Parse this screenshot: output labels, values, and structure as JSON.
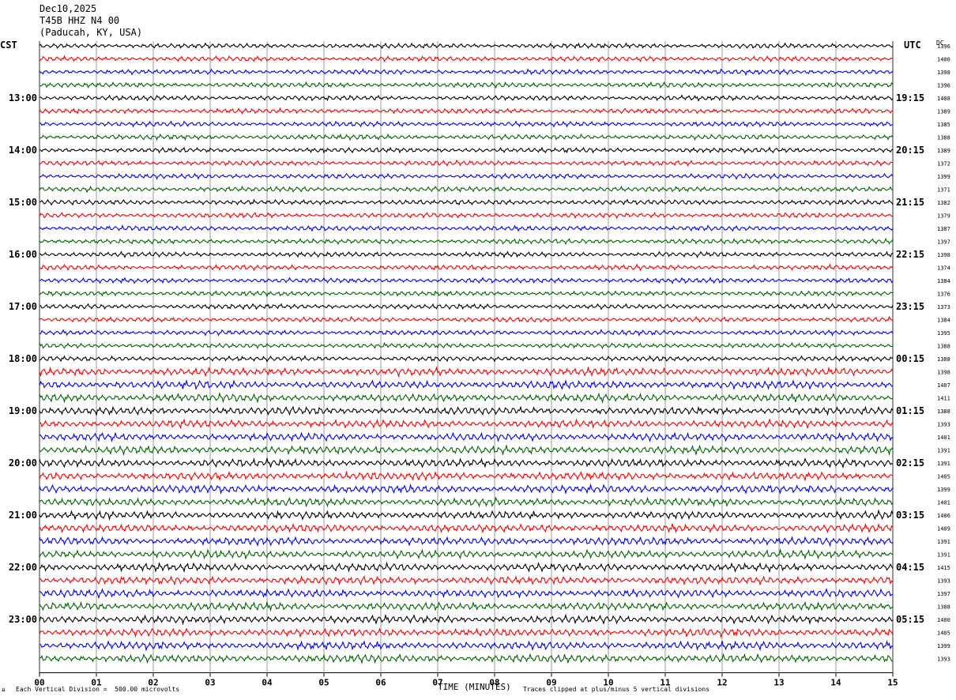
{
  "header": {
    "date": "Dec10,2025",
    "station": "T45B HHZ N4 00",
    "location": "(Paducah, KY, USA)"
  },
  "left_zone": "CST",
  "right_zone": "UTC",
  "dc_label": "DC",
  "footer": {
    "scale_note": "Each Vertical Division =  500.00 microvolts",
    "clip_note": "Traces clipped at plus/minus 5 vertical divisions",
    "corner_mark": "⇊"
  },
  "colors": [
    "#000000",
    "#ff0000",
    "#0000ff",
    "#006400"
  ],
  "chart_data": {
    "type": "line",
    "title": "",
    "xlabel": "TIME (MINUTES)",
    "ylabel": "",
    "xlim": [
      0,
      15
    ],
    "x_ticks": [
      "00",
      "01",
      "02",
      "03",
      "04",
      "05",
      "06",
      "07",
      "08",
      "09",
      "10",
      "11",
      "12",
      "13",
      "14",
      "15"
    ],
    "trace_minutes": 15,
    "trace_count": 48,
    "left_hour_labels": [
      {
        "row": 4,
        "text": "13:00"
      },
      {
        "row": 8,
        "text": "14:00"
      },
      {
        "row": 12,
        "text": "15:00"
      },
      {
        "row": 16,
        "text": "16:00"
      },
      {
        "row": 20,
        "text": "17:00"
      },
      {
        "row": 24,
        "text": "18:00"
      },
      {
        "row": 28,
        "text": "19:00"
      },
      {
        "row": 32,
        "text": "20:00"
      },
      {
        "row": 36,
        "text": "21:00"
      },
      {
        "row": 40,
        "text": "22:00"
      },
      {
        "row": 44,
        "text": "23:00"
      }
    ],
    "right_hour_labels": [
      {
        "row": 4,
        "text": "19:15"
      },
      {
        "row": 8,
        "text": "20:15"
      },
      {
        "row": 12,
        "text": "21:15"
      },
      {
        "row": 16,
        "text": "22:15"
      },
      {
        "row": 20,
        "text": "23:15"
      },
      {
        "row": 24,
        "text": "00:15"
      },
      {
        "row": 28,
        "text": "01:15"
      },
      {
        "row": 32,
        "text": "02:15"
      },
      {
        "row": 36,
        "text": "03:15"
      },
      {
        "row": 40,
        "text": "04:15"
      },
      {
        "row": 44,
        "text": "05:15"
      }
    ],
    "dc_offsets": [
      1396,
      1400,
      1398,
      1396,
      1408,
      1389,
      1385,
      1388,
      1389,
      1372,
      1399,
      1371,
      1382,
      1379,
      1387,
      1397,
      1398,
      1374,
      1384,
      1376,
      1373,
      1384,
      1395,
      1388,
      1388,
      1398,
      1407,
      1411,
      1388,
      1393,
      1401,
      1391,
      1391,
      1405,
      1399,
      1401,
      1406,
      1409,
      1391,
      1391,
      1415,
      1393,
      1397,
      1388,
      1400,
      1405,
      1399,
      1393
    ]
  }
}
